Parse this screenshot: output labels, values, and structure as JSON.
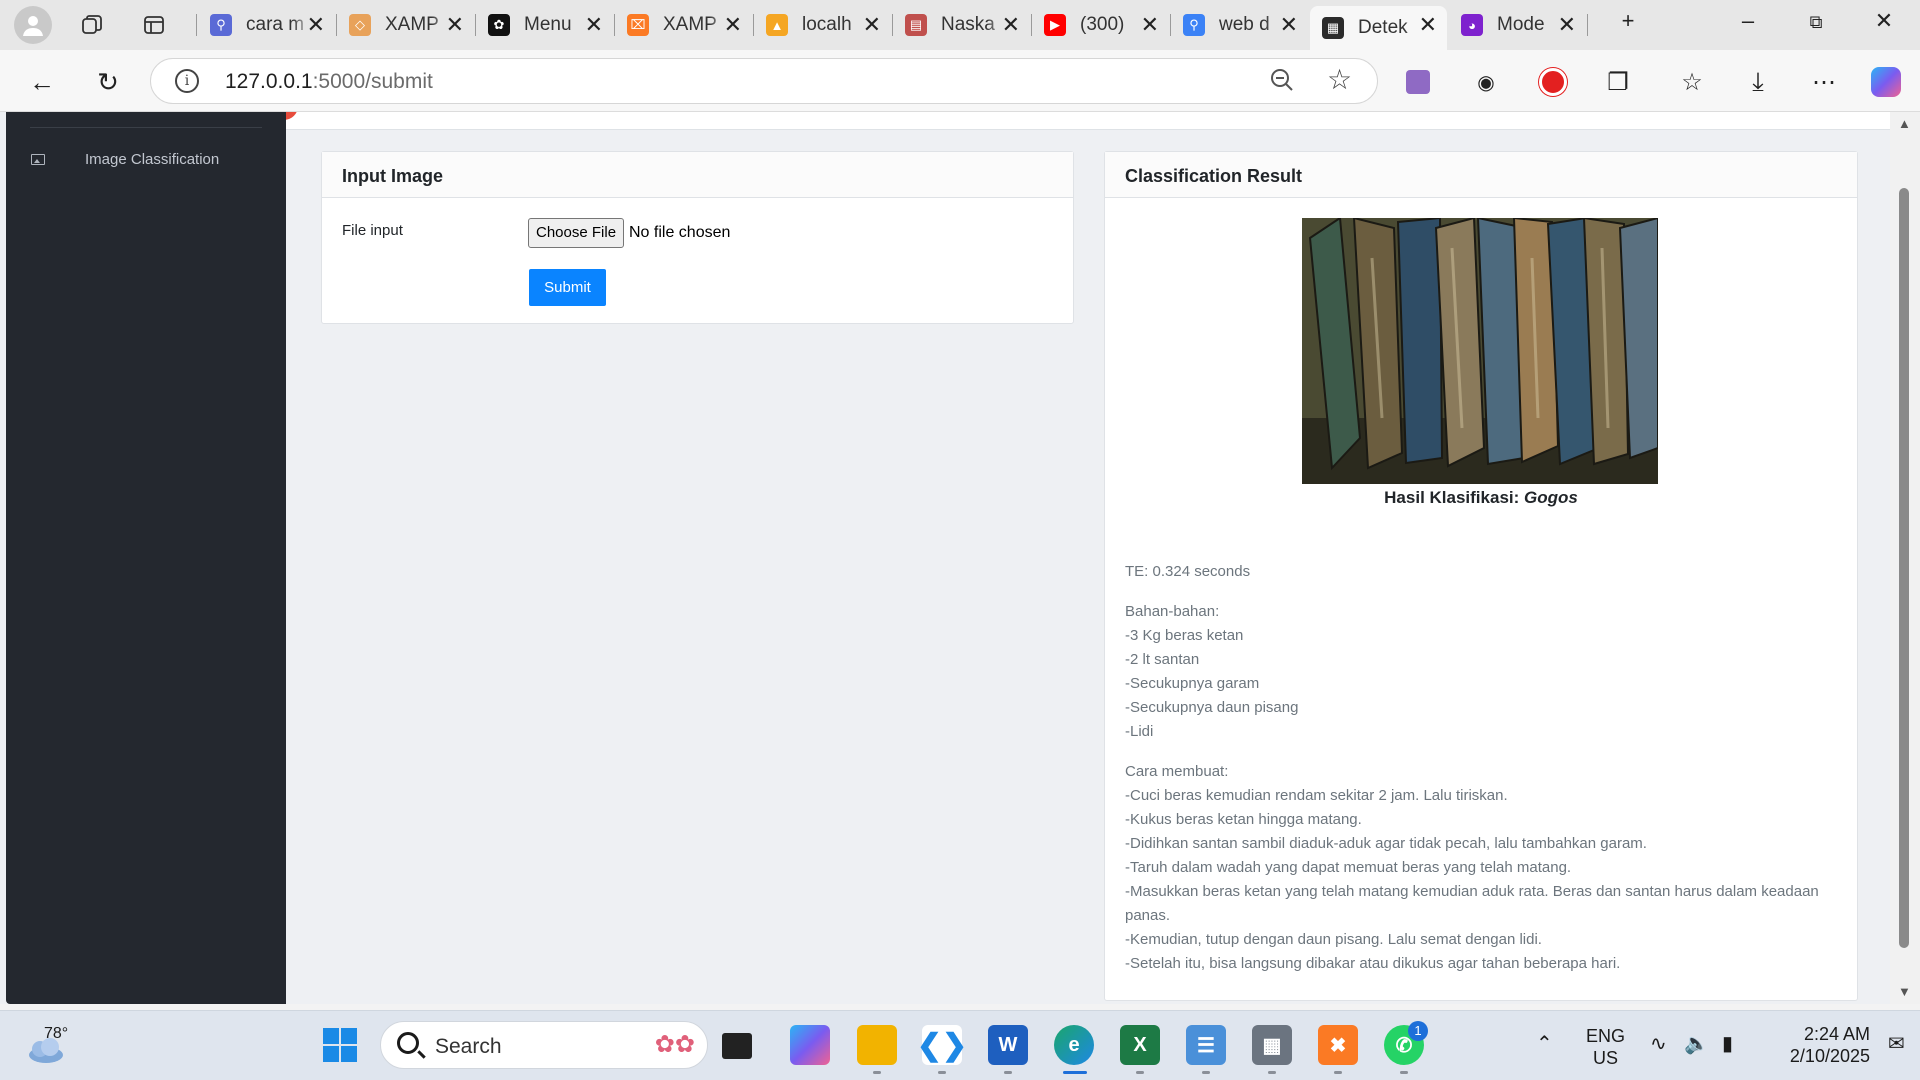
{
  "browser": {
    "tabs": [
      {
        "title": "cara m",
        "icon": "search-icon",
        "color": "#5a6ad6"
      },
      {
        "title": "XAMP",
        "icon": "xampp-diamond-icon",
        "color": "#e8a25a"
      },
      {
        "title": "Menu",
        "icon": "openai-icon",
        "color": "#111111"
      },
      {
        "title": "XAMP",
        "icon": "xampp-icon",
        "color": "#fb7a24"
      },
      {
        "title": "localh",
        "icon": "phpmyadmin-icon",
        "color": "#f5a623"
      },
      {
        "title": "Naska",
        "icon": "pdf-icon",
        "color": "#c0504d"
      },
      {
        "title": "(300)",
        "icon": "youtube-icon",
        "color": "#ff0000"
      },
      {
        "title": "web d",
        "icon": "search-icon",
        "color": "#3b82f6"
      },
      {
        "title": "Detek",
        "icon": "terminal-icon",
        "color": "#2b2b2b",
        "active": true
      },
      {
        "title": "Mode",
        "icon": "model-icon",
        "color": "#7e22ce"
      }
    ],
    "url_host": "127.0.0.1",
    "url_rest": ":5000/submit"
  },
  "sidebar": {
    "items": [
      {
        "label": "Image Classification"
      }
    ]
  },
  "input_card": {
    "title": "Input Image",
    "file_label": "File input",
    "choose_file": "Choose File",
    "file_status": "No file chosen",
    "submit": "Submit"
  },
  "result_card": {
    "title": "Classification Result",
    "caption_prefix": "Hasil Klasifikasi: ",
    "caption_value": "Gogos",
    "time": "TE: 0.324 seconds",
    "ingredients_title": "Bahan-bahan:",
    "ingredients": [
      "-3 Kg beras ketan",
      "-2 lt santan",
      "-Secukupnya garam",
      "-Secukupnya daun pisang",
      "-Lidi"
    ],
    "steps_title": "Cara membuat:",
    "steps": [
      "-Cuci beras kemudian rendam sekitar 2 jam. Lalu tiriskan.",
      "-Kukus beras ketan hingga matang.",
      "-Didihkan santan sambil diaduk-aduk agar tidak pecah, lalu tambahkan garam.",
      "-Taruh dalam wadah yang dapat memuat beras yang telah matang.",
      "-Masukkan beras ketan yang telah matang kemudian aduk rata. Beras dan santan harus dalam keadaan panas.",
      "-Kemudian, tutup dengan daun pisang. Lalu semat dengan lidi.",
      "-Setelah itu, bisa langsung dibakar atau dikukus agar tahan beberapa hari."
    ]
  },
  "taskbar": {
    "weather": "78°",
    "search_placeholder": "Search",
    "lang_top": "ENG",
    "lang_bottom": "US",
    "time": "2:24 AM",
    "date": "2/10/2025",
    "whatsapp_badge": "1"
  },
  "colors": {
    "accent": "#0a84ff",
    "sidebar_bg": "#24282f"
  }
}
